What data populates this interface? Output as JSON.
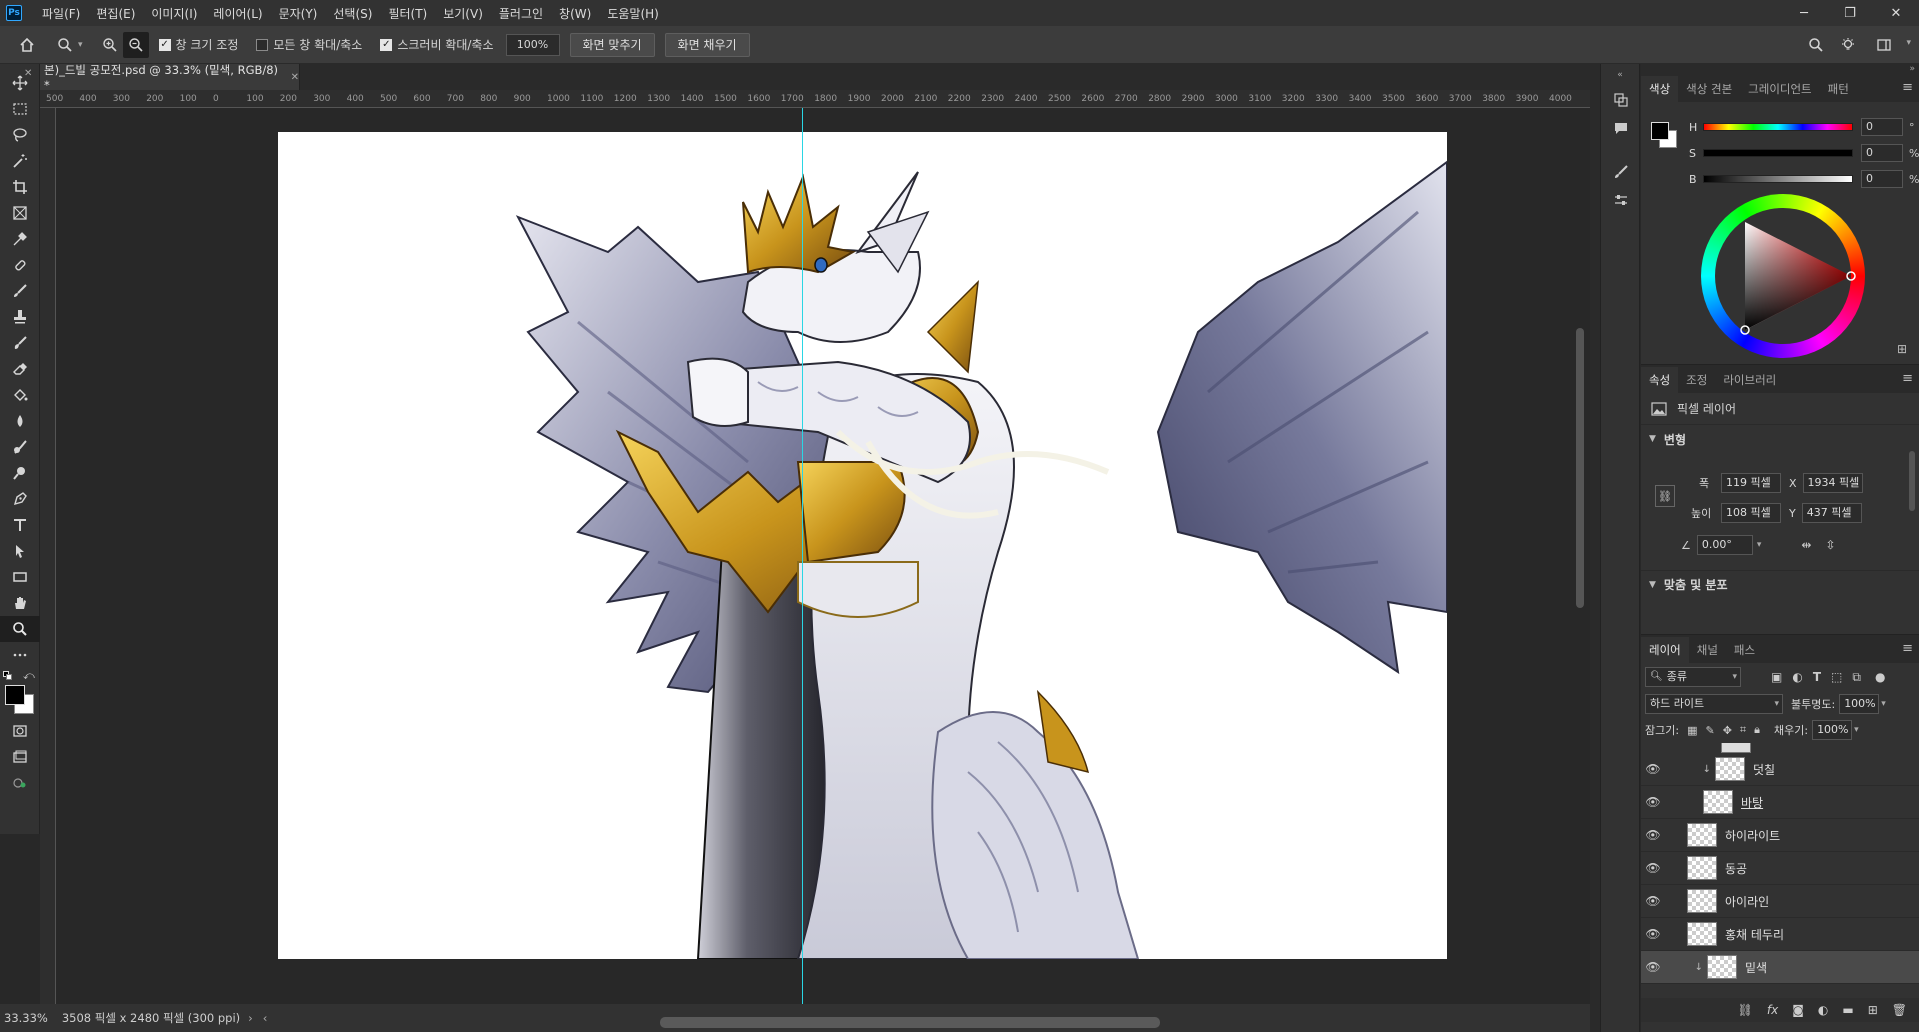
{
  "app": {
    "logo": "Ps"
  },
  "menu": [
    "파일(F)",
    "편집(E)",
    "이미지(I)",
    "레이어(L)",
    "문자(Y)",
    "선택(S)",
    "필터(T)",
    "보기(V)",
    "플러그인",
    "창(W)",
    "도움말(H)"
  ],
  "options": {
    "resize_windows": "창 크기 조정",
    "zoom_all_windows": "모든 창 확대/축소",
    "scrubby_zoom": "스크러비 확대/축소",
    "zoom_value": "100%",
    "fit_screen": "화면 맞추기",
    "fill_screen": "화면 채우기"
  },
  "document": {
    "tab_title": "본)_드빌 공모전.psd @ 33.3% (밑색, RGB/8) *"
  },
  "ruler_ticks": [
    "500",
    "400",
    "300",
    "200",
    "100",
    "0",
    "100",
    "200",
    "300",
    "400",
    "500",
    "600",
    "700",
    "800",
    "900",
    "1000",
    "1100",
    "1200",
    "1300",
    "1400",
    "1500",
    "1600",
    "1700",
    "1800",
    "1900",
    "2000",
    "2100",
    "2200",
    "2300",
    "2400",
    "2500",
    "2600",
    "2700",
    "2800",
    "2900",
    "3000",
    "3100",
    "3200",
    "3300",
    "3400",
    "3500",
    "3600",
    "3700",
    "3800",
    "3900",
    "4000"
  ],
  "status": {
    "zoom": "33.33%",
    "doc_info": "3508 픽셀 x 2480 픽셀 (300 ppi)"
  },
  "color_panel": {
    "tabs": [
      "색상",
      "색상 견본",
      "그레이디언트",
      "패턴"
    ],
    "h_label": "H",
    "h_value": "0",
    "h_unit": "°",
    "s_label": "S",
    "s_value": "0",
    "s_unit": "%",
    "b_label": "B",
    "b_value": "0",
    "b_unit": "%",
    "foreground": "#000000",
    "background": "#ffffff"
  },
  "properties_panel": {
    "tabs": [
      "속성",
      "조정",
      "라이브러리"
    ],
    "type_label": "픽셀 레이어",
    "section_transform": "변형",
    "w_label": "폭",
    "w_value": "119 픽셀",
    "x_label": "X",
    "x_value": "1934 픽셀",
    "h_label": "높이",
    "h_value": "108 픽셀",
    "y_label": "Y",
    "y_value": "437 픽셀",
    "angle_value": "0.00°",
    "section_align": "맞춤 및 분포"
  },
  "layers_panel": {
    "tabs": [
      "레이어",
      "채널",
      "패스"
    ],
    "filter_label": "종류",
    "blend_mode": "하드 라이트",
    "opacity_label": "불투명도:",
    "opacity_value": "100%",
    "lock_label": "잠그기:",
    "fill_label": "채우기:",
    "fill_value": "100%",
    "layers": [
      {
        "name": "덧칠",
        "clipped": true
      },
      {
        "name": "바탕",
        "clipped": false
      },
      {
        "name": "하이라이트",
        "clipped": false
      },
      {
        "name": "동공",
        "clipped": false
      },
      {
        "name": "아이라인",
        "clipped": false
      },
      {
        "name": "홍채 테두리",
        "clipped": false
      },
      {
        "name": "밑색",
        "clipped": true
      }
    ]
  },
  "colors": {
    "guide": "#2ad6e4",
    "accent_gold": "#d4a017",
    "wing_shadow": "#5c5e82"
  }
}
